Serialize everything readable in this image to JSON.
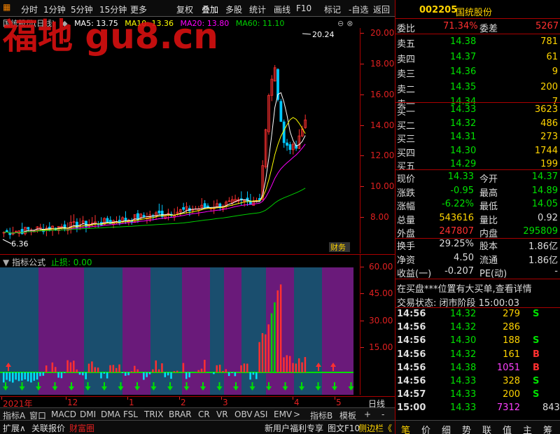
{
  "toolbar": {
    "items": [
      "分时",
      "1分钟",
      "5分钟",
      "15分钟",
      "更多",
      "复权",
      "叠加",
      "多股",
      "统计",
      "画线",
      "F10",
      "标记",
      "-自选",
      "返回"
    ]
  },
  "stock": {
    "code": "002205",
    "name": "国统股份"
  },
  "chart_header": {
    "name": "国统股份(日线)",
    "ma5": "MA5: 13.75",
    "ma10": "MA10: 13.36",
    "ma20": "MA20: 13.80",
    "ma60": "MA60: 11.10"
  },
  "colors": {
    "up": "#ff3030",
    "down": "#00d000",
    "ma5": "#ffffff",
    "ma10": "#ffff00",
    "ma20": "#ff00ff",
    "ma60": "#00d000",
    "axis": "#e02020",
    "price": "#00e000"
  },
  "watermark": "福地 gu8.cn",
  "price_axis": [
    "20.00",
    "18.00",
    "16.00",
    "14.00",
    "12.00",
    "10.00",
    "8.00"
  ],
  "annotations": {
    "high": "20.24",
    "low": "6.36",
    "badge": "财务"
  },
  "indicator": {
    "title": "指标公式",
    "stop": "止损: 0.00",
    "axis": [
      "60.00",
      "45.00",
      "30.00",
      "15.00"
    ]
  },
  "time_axis": {
    "labels": [
      "2021年",
      "12",
      "1",
      "2",
      "3",
      "4",
      "5"
    ],
    "period": "日线"
  },
  "ind_tabs": [
    "指标A",
    "窗口",
    "MACD",
    "DMI",
    "DMA",
    "FSL",
    "TRIX",
    "BRAR",
    "CR",
    "VR",
    "OBV",
    "ASI",
    "EMV",
    ">",
    "指标B",
    "模",
    "板",
    "+",
    "-"
  ],
  "bottom_bar": {
    "left": [
      "扩展∧",
      "关联报价",
      "财富圈"
    ],
    "right": [
      "新用户福利专享",
      "图文F10",
      "侧边栏《"
    ]
  },
  "bottom_keys": [
    "笔",
    "价",
    "细",
    "势",
    "联",
    "值",
    "主",
    "筹"
  ],
  "quote": {
    "webi_label": "委比",
    "webi": "71.34%",
    "wecha_label": "委差",
    "wecha": "5267",
    "asks": [
      {
        "label": "卖五",
        "price": "14.38",
        "vol": "781"
      },
      {
        "label": "卖四",
        "price": "14.37",
        "vol": "61"
      },
      {
        "label": "卖三",
        "price": "14.36",
        "vol": "9"
      },
      {
        "label": "卖二",
        "price": "14.35",
        "vol": "200"
      },
      {
        "label": "卖一",
        "price": "14.34",
        "vol": "7"
      }
    ],
    "bids": [
      {
        "label": "买一",
        "price": "14.33",
        "vol": "3623"
      },
      {
        "label": "买二",
        "price": "14.32",
        "vol": "486"
      },
      {
        "label": "买三",
        "price": "14.31",
        "vol": "273"
      },
      {
        "label": "买四",
        "price": "14.30",
        "vol": "1744"
      },
      {
        "label": "买五",
        "price": "14.29",
        "vol": "199"
      }
    ],
    "stats": [
      {
        "l1": "现价",
        "v1": "14.33",
        "l2": "今开",
        "v2": "14.37"
      },
      {
        "l1": "涨跌",
        "v1": "-0.95",
        "l2": "最高",
        "v2": "14.89"
      },
      {
        "l1": "涨幅",
        "v1": "-6.22%",
        "l2": "最低",
        "v2": "14.05"
      },
      {
        "l1": "总量",
        "v1": "543616",
        "l2": "量比",
        "v2": "0.92"
      },
      {
        "l1": "外盘",
        "v1": "247807",
        "l2": "内盘",
        "v2": "295809"
      }
    ],
    "stats2": [
      {
        "l1": "换手",
        "v1": "29.25%",
        "l2": "股本",
        "v2": "1.86亿"
      },
      {
        "l1": "净资",
        "v1": "4.50",
        "l2": "流通",
        "v2": "1.86亿"
      },
      {
        "l1": "收益(一)",
        "v1": "-0.207",
        "l2": "PE(动)",
        "v2": "-"
      }
    ],
    "notice": "在买盘***位置有大买单,查看详情",
    "trade_state": "交易状态: 闭市阶段 15:00:03",
    "ticks": [
      {
        "t": "14:56",
        "p": "14.32",
        "v": "279",
        "s": "S"
      },
      {
        "t": "14:56",
        "p": "14.32",
        "v": "286",
        "s": ""
      },
      {
        "t": "14:56",
        "p": "14.30",
        "v": "188",
        "s": "S"
      },
      {
        "t": "14:56",
        "p": "14.32",
        "v": "161",
        "s": "B"
      },
      {
        "t": "14:56",
        "p": "14.38",
        "v": "1051",
        "s": "B"
      },
      {
        "t": "14:56",
        "p": "14.33",
        "v": "328",
        "s": "S"
      },
      {
        "t": "14:57",
        "p": "14.33",
        "v": "200",
        "s": "S"
      },
      {
        "t": "15:00",
        "p": "14.33",
        "v": "7312",
        "s": ""
      }
    ],
    "last_extra": "843"
  }
}
